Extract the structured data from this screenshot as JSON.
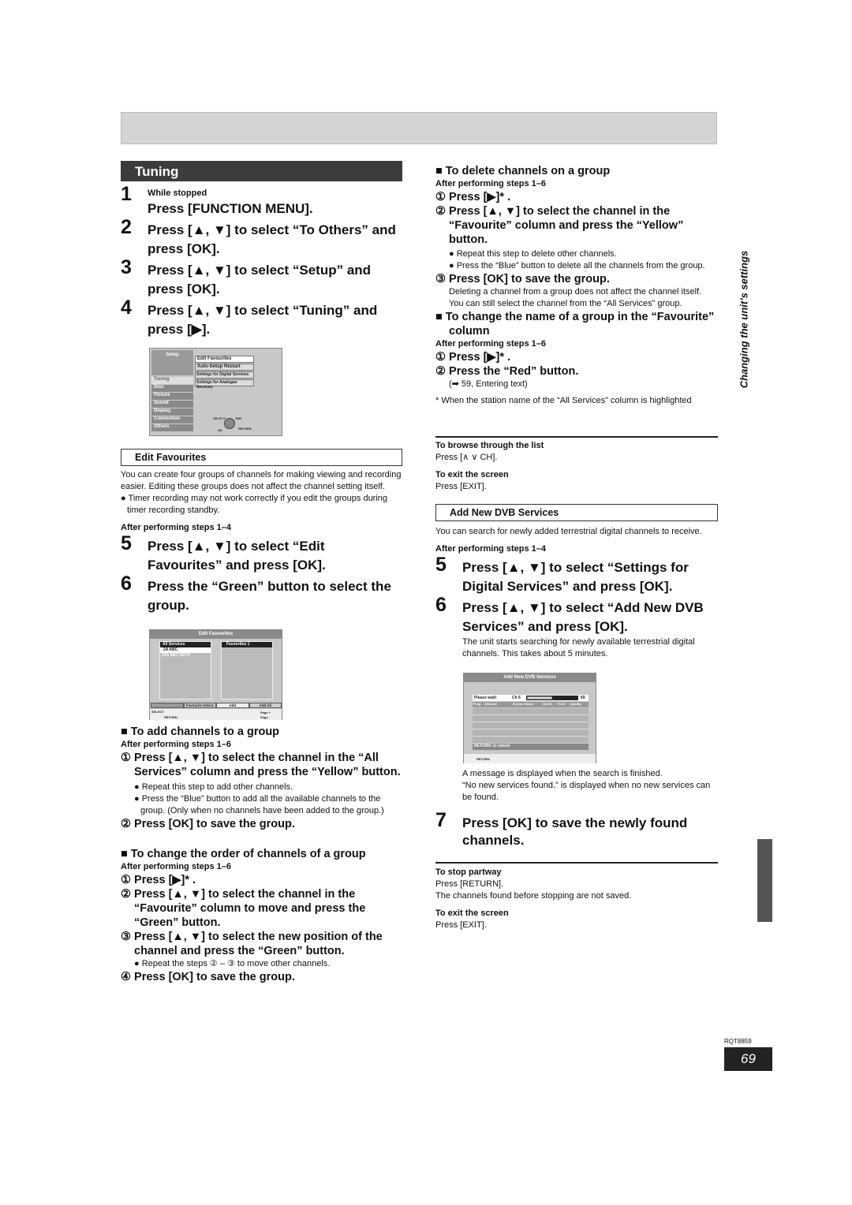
{
  "tuning": {
    "title": "Tuning",
    "step1_pre": "While stopped",
    "step1": "Press [FUNCTION MENU].",
    "step2": "Press [▲, ▼] to select “To Others” and press [OK].",
    "step3": "Press [▲, ▼] to select “Setup” and press [OK].",
    "step4": "Press [▲, ▼] to select “Tuning” and press [▶].",
    "numbers": [
      "1",
      "2",
      "3",
      "4"
    ],
    "setup_screen": {
      "title": "Setup",
      "menu": [
        "Tuning",
        "Disc",
        "Picture",
        "Sound",
        "Display",
        "Connection",
        "Others"
      ],
      "selected": "Tuning",
      "options": [
        "Edit Favourites",
        "Auto-Setup Restart",
        "Settings for Digital Services",
        "Settings for Analogue Services"
      ],
      "nav": {
        "select": "SELECT",
        "tab": "TAB",
        "ok": "OK",
        "return": "RETURN"
      }
    }
  },
  "edit_favourites": {
    "title": "Edit Favourites",
    "intro": "You can create four groups of channels for making viewing and recording easier. Editing these groups does not affect the channel setting itself.",
    "bullet": "Timer recording may not work correctly if you edit the groups during timer recording standby.",
    "after": "After performing steps 1–4",
    "numbers": [
      "5",
      "6"
    ],
    "step5": "Press [▲, ▼] to select “Edit Favourites” and press [OK].",
    "step6": "Press the “Green” button to select the group.",
    "screen": {
      "title": "Edit Favourites",
      "col1": "All Services",
      "col2": "Favourites 1",
      "items": [
        "2A ABC",
        "20A ABC HDTV"
      ],
      "buttons": [
        "",
        "Favourite Select",
        "Add",
        "Add All"
      ],
      "page_plus": "Page +",
      "page_minus": "Page -",
      "select": "SELECT",
      "return": "RETURN"
    },
    "add": {
      "title": "To add channels to a group",
      "after": "After performing steps 1–6",
      "s1": "① Press [▲, ▼] to select the channel in the “All Services” column and press the “Yellow” button.",
      "b1": "Repeat this step to add other channels.",
      "b2": "Press the “Blue” button to add all the available channels to the group. (Only when no channels have been added to the group.)",
      "s2": "② Press [OK] to save the group."
    },
    "order": {
      "title": "To change the order of channels of a group",
      "after": "After performing steps 1–6",
      "s1": "① Press [▶]* .",
      "s2": "② Press [▲, ▼] to select the channel in the “Favourite” column to move and press the “Green” button.",
      "s3": "③ Press [▲, ▼] to select the new position of the channel and press the “Green” button.",
      "b1": "Repeat the steps ② – ③ to move other channels.",
      "s4": "④ Press [OK] to save the group."
    },
    "delete": {
      "title": "To delete channels on a group",
      "after": "After performing steps 1–6",
      "s1": "① Press [▶]* .",
      "s2": "② Press [▲, ▼] to select the channel in the “Favourite” column and press the “Yellow” button.",
      "b1": "Repeat this step to delete other channels.",
      "b2": "Press the “Blue” button to delete all the channels from the group.",
      "s3": "③ Press [OK] to save the group.",
      "note": "Deleting a channel from a group does not affect the channel itself. You can still select the channel from the “All Services” group."
    },
    "rename": {
      "title": "To change the name of a group in the “Favourite” column",
      "after": "After performing steps 1–6",
      "s1": "① Press [▶]* .",
      "s2": "② Press the “Red” button.",
      "ref": "(➡ 59, Entering text)"
    },
    "footnote": "* When the station name of the “All Services” column is highlighted",
    "browse_title": "To browse through the list",
    "browse_text": "Press [∧ ∨ CH].",
    "exit_title": "To exit the screen",
    "exit_text": "Press [EXIT]."
  },
  "add_dvb": {
    "title": "Add New DVB Services",
    "intro": "You can search for newly added terrestrial digital channels to receive.",
    "after": "After performing steps 1–4",
    "numbers": [
      "5",
      "6",
      "7"
    ],
    "step5": "Press [▲, ▼] to select “Settings for Digital Services” and press [OK].",
    "step6": "Press [▲, ▼] to select “Add New DVB Services” and press [OK].",
    "step6_note": "The unit starts searching for newly available terrestrial digital channels. This takes about 5 minutes.",
    "screen": {
      "title": "Add New DVB Services",
      "wait": "Please wait!",
      "ch": "Ch 6",
      "end": "69",
      "progress": 0.5,
      "columns": [
        "Prog.",
        "Channel",
        "Service Name",
        "Net ID",
        "TS ID",
        "Quality"
      ],
      "cancel": "RETURN: to cancel",
      "return": "RETURN"
    },
    "msg1": "A message is displayed when the search is finished.",
    "msg2": "“No new services found.” is displayed when no new services can be found.",
    "step7": "Press [OK] to save the newly found channels.",
    "stop_title": "To stop partway",
    "stop_text": "Press [RETURN].",
    "stop_note": "The channels found before stopping are not saved.",
    "exit_title": "To exit the screen",
    "exit_text": "Press [EXIT]."
  },
  "side_label": "Changing the unit’s settings",
  "doc_code": "RQT8859",
  "page_number": "69"
}
